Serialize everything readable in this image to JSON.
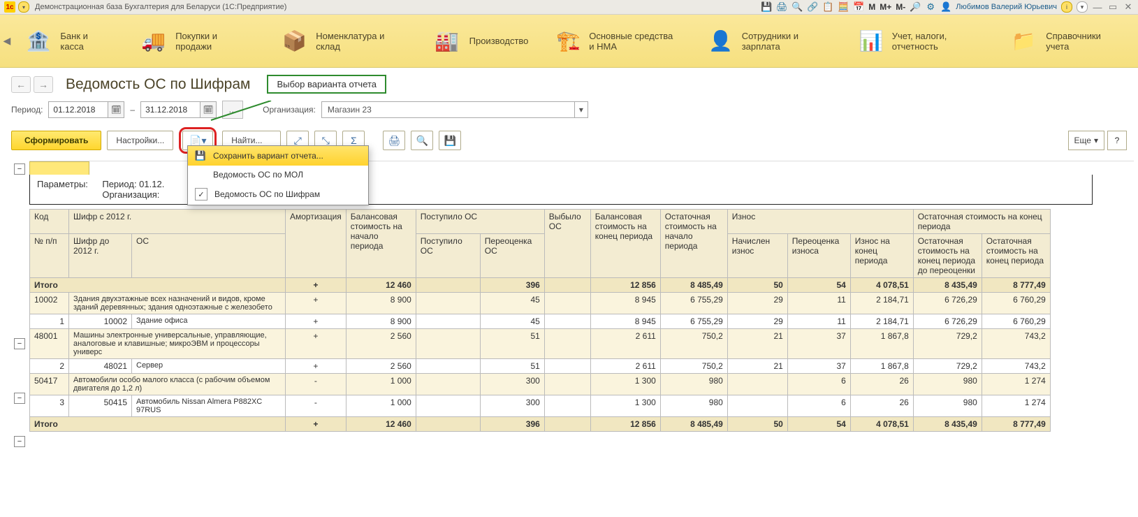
{
  "sysbar": {
    "logo": "1c",
    "title": "Демонстрационная база Бухгалтерия для Беларуси  (1С:Предприятие)",
    "m_items": [
      "M",
      "M+",
      "M-"
    ],
    "user": "Любимов Валерий Юрьевич"
  },
  "sections": [
    {
      "label": "Банк и касса",
      "emoji": "🏦"
    },
    {
      "label": "Покупки и продажи",
      "emoji": "🚚"
    },
    {
      "label": "Номенклатура и склад",
      "emoji": "📦"
    },
    {
      "label": "Производство",
      "emoji": "🏭"
    },
    {
      "label": "Основные средства и НМА",
      "emoji": "🏗️"
    },
    {
      "label": "Сотрудники и зарплата",
      "emoji": "👤"
    },
    {
      "label": "Учет, налоги, отчетность",
      "emoji": "📊"
    },
    {
      "label": "Справочники учета",
      "emoji": "📁"
    }
  ],
  "page": {
    "title": "Ведомость ОС по Шифрам",
    "callout": "Выбор варианта отчета"
  },
  "period": {
    "label": "Период:",
    "from": "01.12.2018",
    "dash": "–",
    "to": "31.12.2018",
    "org_label": "Организация:",
    "org_value": "Магазин 23"
  },
  "actions": {
    "form": "Сформировать",
    "settings": "Настройки...",
    "find": "Найти...",
    "more": "Еще"
  },
  "dropdown": {
    "save": "Сохранить вариант отчета...",
    "by_mol": "Ведомость ОС по МОЛ",
    "by_sh": "Ведомость ОС по Шифрам"
  },
  "params": {
    "l1": "Параметры:",
    "l2": "Период: 01.12.",
    "l3": "Организация:"
  },
  "headers": {
    "kod": "Код",
    "shifr2012": "Шифр с 2012 г.",
    "amort": "Амортизация",
    "balstart": "Балансовая стоимость на начало периода",
    "post": "Поступило ОС",
    "post2": "Поступило ОС",
    "pereoc": "Переоценка ОС",
    "vyb": "Выбыло ОС",
    "balend": "Балансовая стоимость на конец периода",
    "oststart": "Остаточная стоимость на начало периода",
    "iznos": "Износ",
    "nach": "Начислен износ",
    "per_izn": "Переоценка износа",
    "izn_end": "Износ на конец периода",
    "ost_end_group": "Остаточная стоимость на конец периода",
    "ost_pre": "Остаточная стоимость на конец периода до переоценки",
    "ost_end": "Остаточная стоимость на конец периода",
    "npp": "№ п/п",
    "shifr_do": "Шифр до 2012 г.",
    "os": "ОС"
  },
  "rows": {
    "total_label": "Итого",
    "itogo": {
      "am": "+",
      "bal": "12 460",
      "post": "",
      "per": "396",
      "vyb": "",
      "balend": "12 856",
      "oststart": "8 485,49",
      "nach": "50",
      "periz": "54",
      "iznend": "4 078,51",
      "ostpre": "8 435,49",
      "ostend": "8 777,49"
    },
    "g1": {
      "kod": "10002",
      "name": "Здания двухэтажные всех назначений и видов, кроме зданий деревянных; здания одноэтажные с железобето",
      "am": "+",
      "bal": "8 900",
      "post": "",
      "per": "45",
      "vyb": "",
      "balend": "8 945",
      "oststart": "6 755,29",
      "nach": "29",
      "periz": "11",
      "iznend": "2 184,71",
      "ostpre": "6 726,29",
      "ostend": "6 760,29"
    },
    "r1": {
      "n": "1",
      "kod": "10002",
      "name": "Здание офиса",
      "am": "+",
      "bal": "8 900",
      "post": "",
      "per": "45",
      "vyb": "",
      "balend": "8 945",
      "oststart": "6 755,29",
      "nach": "29",
      "periz": "11",
      "iznend": "2 184,71",
      "ostpre": "6 726,29",
      "ostend": "6 760,29"
    },
    "g2": {
      "kod": "48001",
      "name": "Машины электронные универсальные, управляющие, аналоговые и клавишные; микроЭВМ и процессоры универс",
      "am": "+",
      "bal": "2 560",
      "post": "",
      "per": "51",
      "vyb": "",
      "balend": "2 611",
      "oststart": "750,2",
      "nach": "21",
      "periz": "37",
      "iznend": "1 867,8",
      "ostpre": "729,2",
      "ostend": "743,2"
    },
    "r2": {
      "n": "2",
      "kod": "48021",
      "name": "Сервер",
      "am": "+",
      "bal": "2 560",
      "post": "",
      "per": "51",
      "vyb": "",
      "balend": "2 611",
      "oststart": "750,2",
      "nach": "21",
      "periz": "37",
      "iznend": "1 867,8",
      "ostpre": "729,2",
      "ostend": "743,2"
    },
    "g3": {
      "kod": "50417",
      "name": "Автомобили особо малого класса (с рабочим объемом двигателя до 1,2 л)",
      "am": "-",
      "bal": "1 000",
      "post": "",
      "per": "300",
      "vyb": "",
      "balend": "1 300",
      "oststart": "980",
      "nach": "",
      "periz": "6",
      "iznend": "26",
      "ostpre": "980",
      "ostend": "1 274"
    },
    "r3": {
      "n": "3",
      "kod": "50415",
      "name": "Автомобиль Nissan Almera P882XC 97RUS",
      "am": "-",
      "bal": "1 000",
      "post": "",
      "per": "300",
      "vyb": "",
      "balend": "1 300",
      "oststart": "980",
      "nach": "",
      "periz": "6",
      "iznend": "26",
      "ostpre": "980",
      "ostend": "1 274"
    }
  }
}
